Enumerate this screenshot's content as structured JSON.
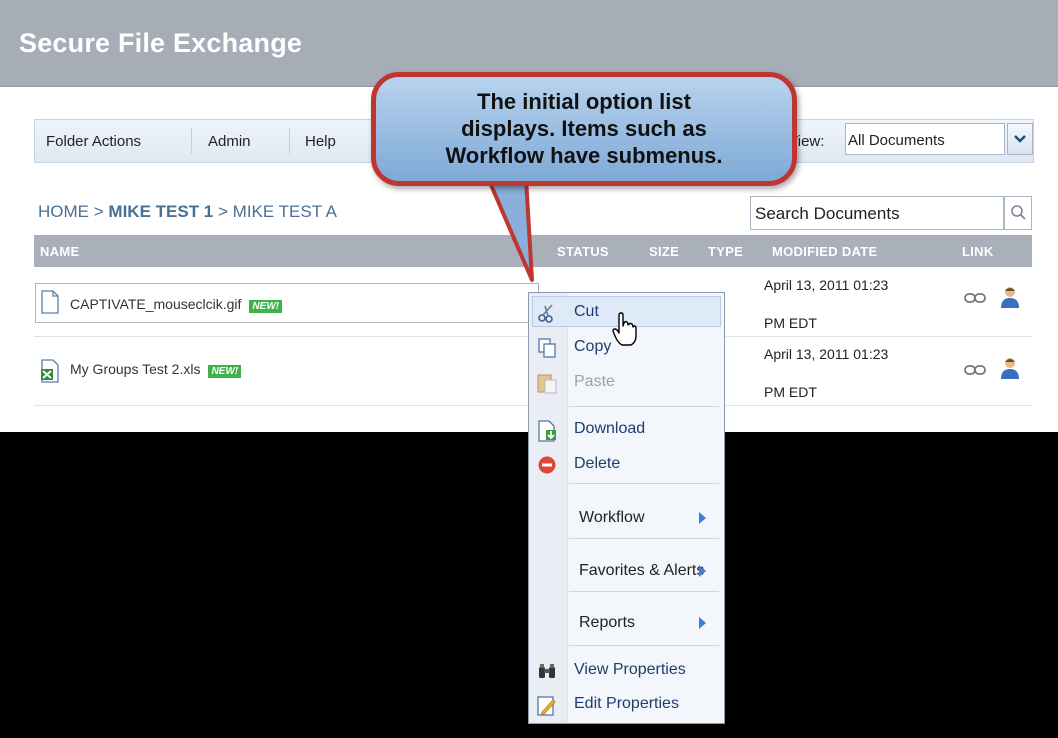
{
  "app": {
    "title": "Secure File Exchange"
  },
  "menubar": {
    "items": [
      "Folder Actions",
      "Admin",
      "Help"
    ],
    "view_label": "View:",
    "view_value": "All Documents"
  },
  "breadcrumb": {
    "home": "HOME",
    "sep1": ">",
    "level1": "MIKE TEST 1",
    "sep2": ">",
    "level2": "MIKE TEST A"
  },
  "search": {
    "placeholder": "Search Documents"
  },
  "table": {
    "headers": {
      "name": "NAME",
      "status": "STATUS",
      "size": "SIZE",
      "type": "TYPE",
      "modified": "MODIFIED DATE",
      "link": "LINK"
    },
    "rows": [
      {
        "name": "CAPTIVATE_mouseclcik.gif",
        "badge": "NEW!",
        "modified_line1": "April 13, 2011 01:23",
        "modified_line2": "PM EDT",
        "file_icon": "document-icon"
      },
      {
        "name": "My Groups Test 2.xls",
        "badge": "NEW!",
        "modified_line1": "April 13, 2011 01:23",
        "modified_line2": "PM EDT",
        "file_icon": "excel-icon"
      }
    ]
  },
  "context_menu": {
    "items": [
      {
        "label": "Cut",
        "icon": "scissors-icon",
        "enabled": true,
        "hover": true
      },
      {
        "label": "Copy",
        "icon": "copy-icon",
        "enabled": true
      },
      {
        "label": "Paste",
        "icon": "paste-icon",
        "enabled": false
      },
      {
        "label": "Download",
        "icon": "download-icon",
        "enabled": true
      },
      {
        "label": "Delete",
        "icon": "delete-icon",
        "enabled": true
      },
      {
        "label": "Workflow",
        "submenu": true
      },
      {
        "label": "Favorites & Alerts",
        "submenu": true
      },
      {
        "label": "Reports",
        "submenu": true
      },
      {
        "label": "View Properties",
        "icon": "binoculars-icon",
        "enabled": true
      },
      {
        "label": "Edit Properties",
        "icon": "edit-icon",
        "enabled": true
      }
    ]
  },
  "callout": {
    "lines": [
      "The initial option list",
      "displays. Items such as",
      "Workflow have submenus."
    ]
  },
  "colors": {
    "accent_link": "#4a6f95",
    "callout_border": "#c0352f",
    "new_badge": "#3bb34a",
    "header_bar": "#a7adb7"
  }
}
